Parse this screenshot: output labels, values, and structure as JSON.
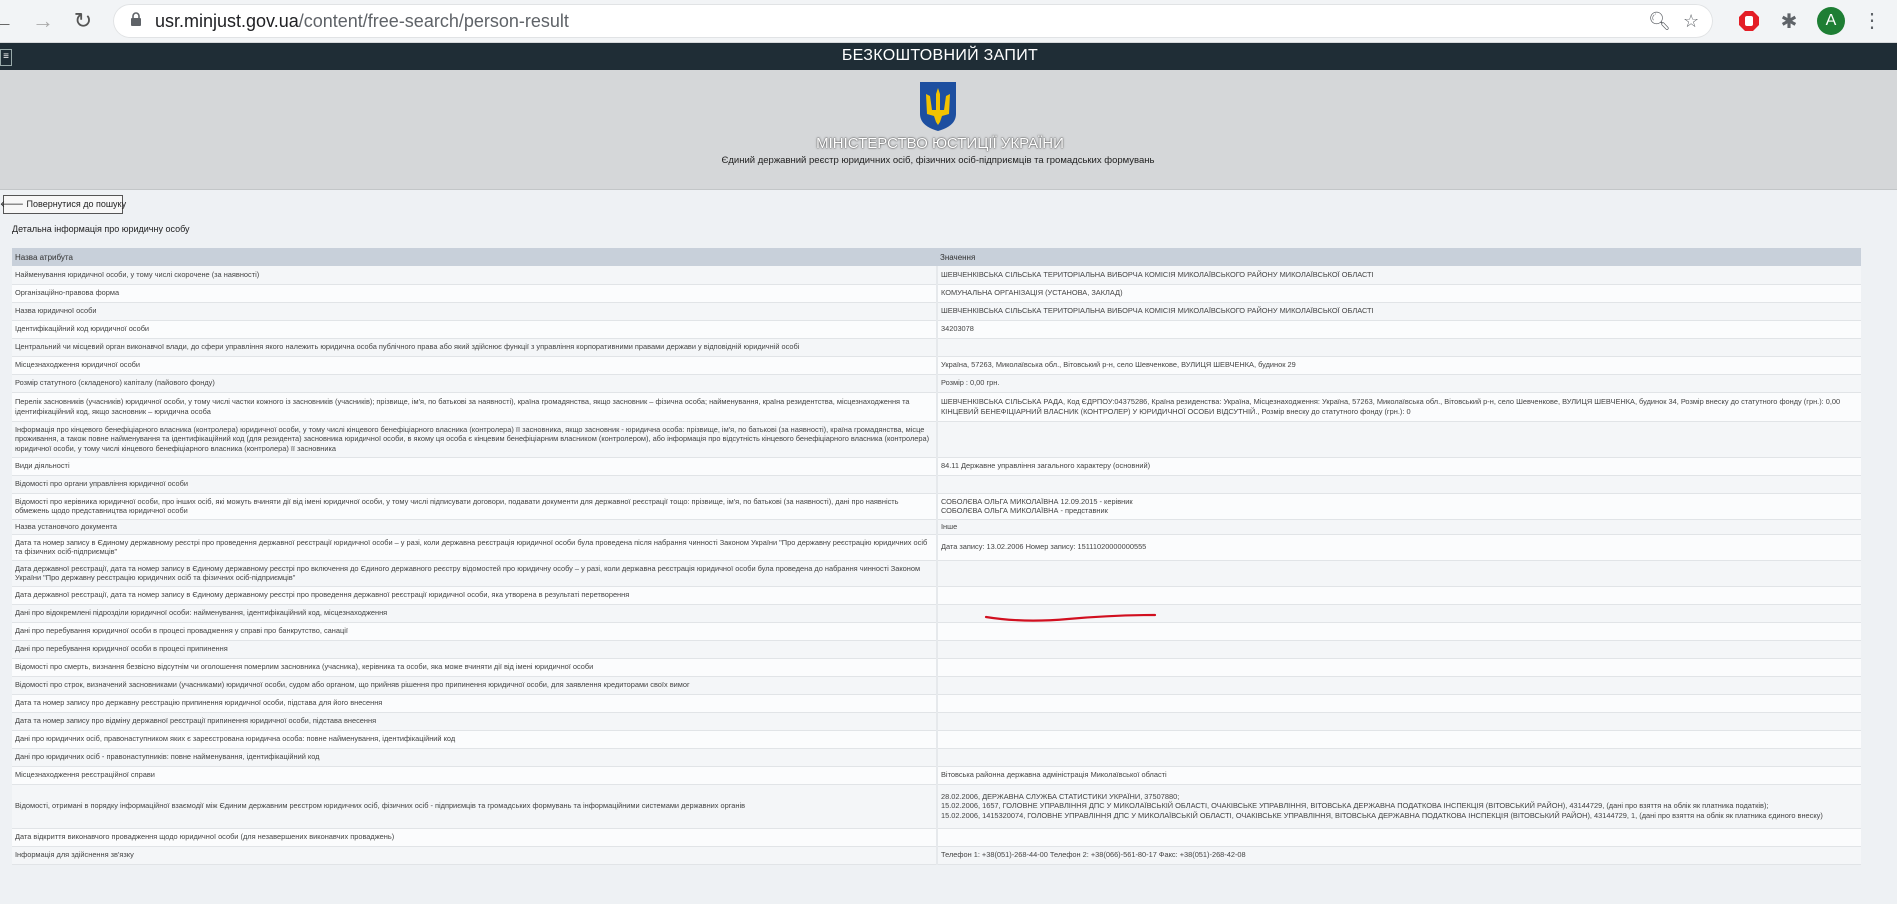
{
  "browser": {
    "url_host": "usr.minjust.gov.ua",
    "url_path": "/content/free-search/person-result",
    "avatar_letter": "A"
  },
  "page": {
    "topbar_title": "БЕЗКОШТОВНИЙ ЗАПИТ",
    "ministry": "МІНІСТЕРСТВО ЮСТИЦІЇ УКРАЇНИ",
    "registry": "Єдиний державний реєстр юридичних осіб, фізичних осіб-підприємців та громадських формувань",
    "back_button": "🡐 Повернутися до пошуку",
    "detail_title": "Детальна інформація про юридичну особу"
  },
  "table": {
    "col_attr": "Назва атрибута",
    "col_value": "Значення",
    "rows": [
      {
        "attr": "Найменування юридичної особи, у тому числі скорочене (за наявності)",
        "value": "ШЕВЧЕНКІВСЬКА СІЛЬСЬКА ТЕРИТОРІАЛЬНА ВИБОРЧА КОМІСІЯ МИКОЛАЇВСЬКОГО РАЙОНУ МИКОЛАЇВСЬКОЇ ОБЛАСТІ"
      },
      {
        "attr": "Організаційно-правова форма",
        "value": "КОМУНАЛЬНА ОРГАНІЗАЦІЯ (УСТАНОВА, ЗАКЛАД)"
      },
      {
        "attr": "Назва юридичної особи",
        "value": "ШЕВЧЕНКІВСЬКА СІЛЬСЬКА ТЕРИТОРІАЛЬНА ВИБОРЧА КОМІСІЯ МИКОЛАЇВСЬКОГО РАЙОНУ МИКОЛАЇВСЬКОЇ ОБЛАСТІ"
      },
      {
        "attr": "Ідентифікаційний код юридичної особи",
        "value": "34203078"
      },
      {
        "attr": "Центральний чи місцевий орган виконавчої влади, до сфери управління якого належить юридична особа публічного права або який здійснює функції з управління корпоративними правами держави у відповідній юридичній особі",
        "value": ""
      },
      {
        "attr": "Місцезнаходження юридичної особи",
        "value": "Україна, 57263, Миколаївська обл., Вітовський р-н, село Шевченкове, ВУЛИЦЯ ШЕВЧЕНКА, будинок 29"
      },
      {
        "attr": "Розмір статутного (складеного) капіталу (пайового фонду)",
        "value": "Розмір : 0,00 грн."
      },
      {
        "attr": "Перелік засновників (учасників) юридичної особи, у тому числі частки кожного із засновників (учасників); прізвище, ім'я, по батькові за наявності), країна громадянства, якщо засновник – фізична особа; найменування, країна резидентства, місцезнаходження та ідентифікаційний код, якщо засновник – юридична особа",
        "value": "ШЕВЧЕНКІВСЬКА СІЛЬСЬКА РАДА, Код ЄДРПОУ:04375286, Країна резиденства: Україна, Місцезнаходження: Україна, 57263, Миколаївська обл., Вітовський р-н, село Шевченкове, ВУЛИЦЯ ШЕВЧЕНКА, будинок 34, Розмір внеску до статутного фонду (грн.): 0,00\nКІНЦЕВИЙ БЕНЕФІЦІАРНИЙ ВЛАСНИК (КОНТРОЛЕР) У ЮРИДИЧНОЇ ОСОБИ ВІДСУТНІЙ., Розмір внеску до статутного фонду (грн.): 0"
      },
      {
        "attr": "Інформація про кінцевого бенефіціарного власника (контролера) юридичної особи, у тому числі кінцевого бенефіціарного власника (контролера) її засновника, якщо засновник - юридична особа: прізвище, ім'я, по батькові (за наявності), країна громадянства, місце проживання, а також повне найменування та ідентифікаційний код (для резидента) засновника юридичної особи, в якому ця особа є кінцевим бенефіціарним власником (контролером), або інформація про відсутність кінцевого бенефіціарного власника (контролера) юридичної особи, у тому числі кінцевого бенефіціарного власника (контролера) її засновника",
        "value": ""
      },
      {
        "attr": "Види діяльності",
        "value": "84.11 Державне управління загального характеру (основний)"
      },
      {
        "attr": "Відомості про органи управління юридичної особи",
        "value": ""
      },
      {
        "attr": "Відомості про керівника юридичної особи, про інших осіб, які можуть вчиняти дії від імені юридичної особи, у тому числі підписувати договори, подавати документи для державної реєстрації тощо: прізвище, ім'я, по батькові (за наявності), дані про наявність обмежень щодо представництва юридичної особи",
        "value": "СОБОЛЄВА ОЛЬГА МИКОЛАЇВНА 12.09.2015 - керівник\nСОБОЛЄВА ОЛЬГА МИКОЛАЇВНА - представник"
      },
      {
        "attr": "Назва установчого документа",
        "value": "Інше"
      },
      {
        "attr": "Дата та номер запису в Єдиному державному реєстрі про проведення державної реєстрації юридичної особи – у разі, коли державна реєстрація юридичної особи була проведена після набрання чинності Законом України \"Про державну реєстрацію юридичних осіб та фізичних осіб-підприємців\"",
        "value": "Дата запису: 13.02.2006 Номер запису: 15111020000000555"
      },
      {
        "attr": "Дата державної реєстрації, дата та номер запису в Єдиному державному реєстрі про включення до Єдиного державного реєстру відомостей про юридичну особу – у разі, коли державна реєстрація юридичної особи була проведена до набрання чинності Законом України \"Про державну реєстрацію юридичних осіб та фізичних осіб-підприємців\"",
        "value": ""
      },
      {
        "attr": "Дата державної реєстрації, дата та номер запису в Єдиному державному реєстрі про проведення державної реєстрації юридичної особи, яка утворена в результаті перетворення",
        "value": ""
      },
      {
        "attr": "Дані про відокремлені підрозділи юридичної особи: найменування, ідентифікаційний код, місцезнаходження",
        "value": ""
      },
      {
        "attr": "Дані про перебування юридичної особи в процесі провадження у справі про банкрутство, санації",
        "value": ""
      },
      {
        "attr": "Дані про перебування юридичної особи в процесі припинення",
        "value": ""
      },
      {
        "attr": "Відомості про смерть, визнання безвісно відсутнім чи оголошення померлим засновника (учасника), керівника та особи, яка може вчиняти дії від імені юридичної особи",
        "value": ""
      },
      {
        "attr": "Відомості про строк, визначений засновниками (учасниками) юридичної особи, судом або органом, що прийняв рішення про припинення юридичної особи, для заявлення кредиторами своїх вимог",
        "value": ""
      },
      {
        "attr": "Дата та номер запису про державну реєстрацію припинення юридичної особи, підстава для його внесення",
        "value": ""
      },
      {
        "attr": "Дата та номер запису про відміну державної реєстрації припинення юридичної особи, підстава внесення",
        "value": ""
      },
      {
        "attr": "Дані про юридичних осіб, правонаступником яких є зареєстрована юридична особа: повне найменування, ідентифікаційний код",
        "value": ""
      },
      {
        "attr": "Дані про юридичних осіб - правонаступників: повне найменування, ідентифікаційний код",
        "value": ""
      },
      {
        "attr": "Місцезнаходження реєстраційної справи",
        "value": "Вітовська районна державна адміністрація Миколаївської області"
      },
      {
        "attr": "Відомості, отримані в порядку інформаційної взаємодії між Єдиним державним реєстром юридичних осіб, фізичних осіб - підприємців та громадських формувань та інформаційними системами державних органів",
        "value": "28.02.2006, ДЕРЖАВНА СЛУЖБА СТАТИСТИКИ УКРАЇНИ, 37507880;\n15.02.2006, 1657, ГОЛОВНЕ УПРАВЛІННЯ ДПС У МИКОЛАЇВСЬКІЙ ОБЛАСТІ, ОЧАКІВСЬКЕ УПРАВЛІННЯ, ВІТОВСЬКА ДЕРЖАВНА ПОДАТКОВА ІНСПЕКЦІЯ (ВІТОВСЬКИЙ РАЙОН), 43144729, (дані про взяття на облік як платника податків);\n15.02.2006, 1415320074, ГОЛОВНЕ УПРАВЛІННЯ ДПС У МИКОЛАЇВСЬКІЙ ОБЛАСТІ, ОЧАКІВСЬКЕ УПРАВЛІННЯ, ВІТОВСЬКА ДЕРЖАВНА ПОДАТКОВА ІНСПЕКЦІЯ (ВІТОВСЬКИЙ РАЙОН), 43144729, 1, (дані про взяття на облік як платника єдиного внеску)"
      },
      {
        "attr": "Дата відкриття виконавчого провадження щодо юридичної особи (для незавершених виконавчих проваджень)",
        "value": ""
      },
      {
        "attr": "Інформація для здійснення зв'язку",
        "value": "Телефон 1: +38(051)-268-44-00 Телефон 2: +38(066)-561-80-17 Факс: +38(051)-268-42-08"
      }
    ]
  }
}
